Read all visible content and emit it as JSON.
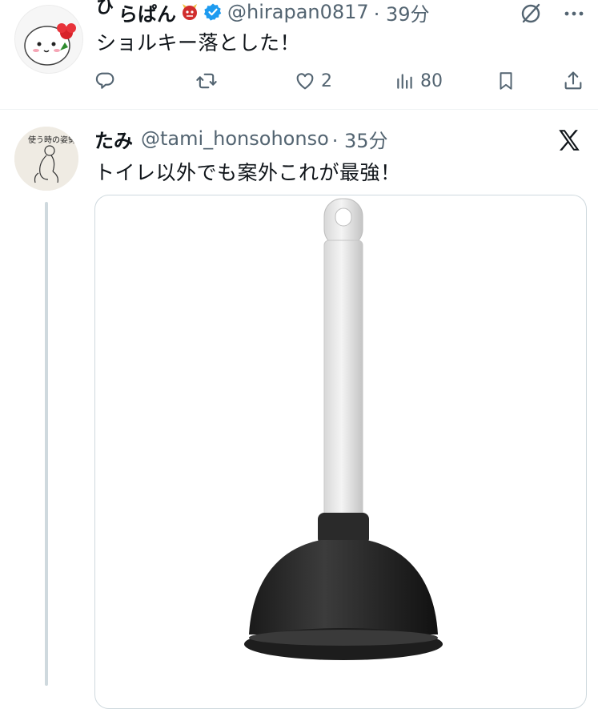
{
  "tweet1": {
    "name": "らぱん",
    "name_prefix": "ひ",
    "handle": "@hirapan0817",
    "time": "· 39分",
    "text": "ショルキー落とした！",
    "likes": "2",
    "views": "80"
  },
  "tweet2": {
    "name": "たみ",
    "handle": "@tami_honsohonso",
    "time": "· 35分",
    "text": "トイレ以外でも案外これが最強！",
    "avatar_caption": "使う時の姿勢"
  },
  "colors": {
    "text": "#0f1419",
    "secondary": "#536471",
    "verified": "#1d9bf0",
    "border": "#cfd9de"
  },
  "icons": [
    "reply-icon",
    "retweet-icon",
    "heart-icon",
    "analytics-icon",
    "bookmark-icon",
    "share-icon",
    "grok-icon",
    "more-icon",
    "x-logo-icon",
    "verified-icon"
  ]
}
